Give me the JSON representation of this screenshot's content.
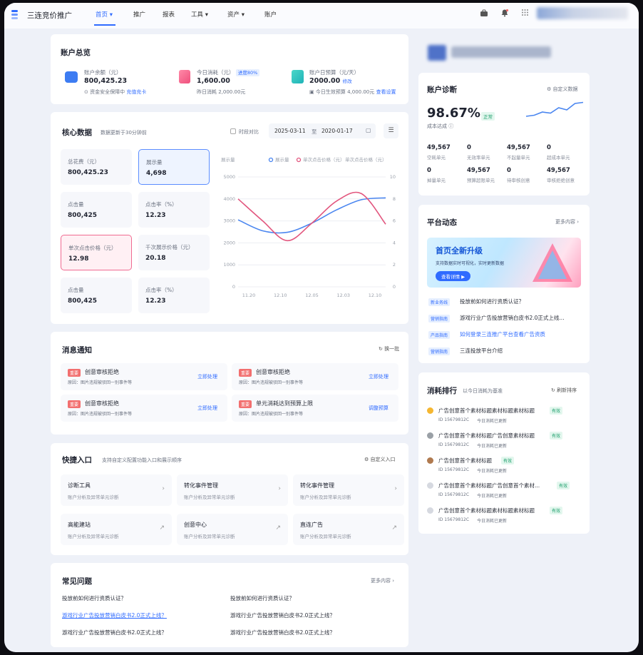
{
  "app": {
    "brand": "三连竞价推广"
  },
  "nav": {
    "items": [
      "首页 ▾",
      "推广",
      "报表",
      "工具 ▾",
      "资产 ▾",
      "账户"
    ]
  },
  "overview": {
    "title": "账户总览",
    "balance": {
      "label": "账户余额（元）",
      "value": "800,425.23",
      "sub": "资金安全保障中",
      "link": "充值充卡"
    },
    "today": {
      "label": "今日消耗（元）",
      "badge": "进度80%",
      "value": "1,600.00",
      "sub": "昨日消耗 2,000.00元"
    },
    "budget": {
      "label": "账户日预算（元/天）",
      "value": "2000.00",
      "edit": "修改",
      "sub": "今日生效预算 4,000.00元",
      "link": "查看设置"
    }
  },
  "core": {
    "title": "核心数据",
    "subtitle": "数据更新于30分钟前",
    "compare_label": "时段对比",
    "date_start": "2025-03-11",
    "date_sep": "至",
    "date_end": "2020-01-17",
    "tiles": [
      {
        "label": "总花费（元）",
        "value": "800,425.23"
      },
      {
        "label": "展示量",
        "value": "4,698"
      },
      {
        "label": "点击量",
        "value": "800,425"
      },
      {
        "label": "点击率（%）",
        "value": "12.23"
      },
      {
        "label": "单次点击价格（元）",
        "value": "12.98"
      },
      {
        "label": "千次展示价格（元）",
        "value": "20.18"
      },
      {
        "label": "点击量",
        "value": "800,425"
      },
      {
        "label": "点击率（%）",
        "value": "12.23"
      }
    ]
  },
  "chart_data": {
    "type": "line",
    "x": [
      "11.20",
      "12.10",
      "12.05",
      "12.03",
      "12.10"
    ],
    "yleft_label": "展示量",
    "yleft_ticks": [
      0,
      1000,
      2000,
      3000,
      4000,
      5000
    ],
    "yright_ticks": [
      0,
      2,
      4,
      6,
      8,
      10
    ],
    "legend": [
      "展示量",
      "单次点击价格（元）",
      "单次点击价格（元）"
    ],
    "series": [
      {
        "name": "展示量",
        "axis": "left",
        "color": "#4a86f0",
        "values": [
          3050,
          2550,
          2480,
          2900,
          3500,
          3960,
          4050
        ]
      },
      {
        "name": "单次点击价格（元）",
        "axis": "right",
        "color": "#e2567e",
        "values": [
          8.0,
          6.0,
          4.2,
          5.8,
          7.8,
          8.5,
          5.7
        ]
      }
    ],
    "ylim_left": [
      0,
      5000
    ],
    "ylim_right": [
      0,
      10
    ]
  },
  "messages": {
    "title": "消息通知",
    "refresh": "换一批",
    "items": [
      {
        "tag": "重要",
        "title": "创意审核拒绝",
        "desc": "原因：图片违规被驳回一别事件等",
        "action": "立即处理"
      },
      {
        "tag": "重要",
        "title": "创意审核拒绝",
        "desc": "原因：图片违规被驳回一别事件等",
        "action": "立即处理"
      },
      {
        "tag": "重要",
        "title": "创意审核拒绝",
        "desc": "原因：图片违规被驳回一别事件等",
        "action": "立即处理"
      },
      {
        "tag": "重要",
        "title": "单元消耗达到预算上限",
        "desc": "原因：图片违规被驳回一别事件等",
        "action": "调整预算"
      }
    ]
  },
  "quick": {
    "title": "快捷入口",
    "subtitle": "支持自定义配置功能入口和展示顺序",
    "custom": "自定义入口",
    "items": [
      {
        "title": "诊断工具",
        "desc": "账户分析及异常单元诊断",
        "arrow": "›"
      },
      {
        "title": "转化事件管理",
        "desc": "账户分析及异常单元诊断",
        "arrow": "›"
      },
      {
        "title": "转化事件管理",
        "desc": "账户分析及异常单元诊断",
        "arrow": "›"
      },
      {
        "title": "高能建站",
        "desc": "账户分析及异常单元诊断",
        "arrow": "↗"
      },
      {
        "title": "创意中心",
        "desc": "账户分析及异常单元诊断",
        "arrow": "↗"
      },
      {
        "title": "直连广告",
        "desc": "账户分析及异常单元诊断",
        "arrow": "↗"
      }
    ]
  },
  "faq": {
    "title": "常见问题",
    "more": "更多内容 ›",
    "items": [
      "投放前如何进行资质认证？",
      "投放前如何进行资质认证？",
      "游戏行业广告投放营销白皮书2.0正式上线？",
      "游戏行业广告投放营销白皮书2.0正式上线？",
      "游戏行业广告投放营销白皮书2.0正式上线？",
      "游戏行业广告投放营销白皮书2.0正式上线？"
    ]
  },
  "diagnosis": {
    "title": "账户诊断",
    "custom": "自定义数据",
    "score": "98.67%",
    "score_badge": "正常",
    "score_label": "成本达成",
    "sparkline": [
      0.3,
      0.35,
      0.5,
      0.45,
      0.7,
      0.6,
      0.9,
      0.95
    ],
    "stats": [
      {
        "value": "49,567",
        "label": "空耗单元"
      },
      {
        "value": "0",
        "label": "无效率单元"
      },
      {
        "value": "49,567",
        "label": "不起量单元"
      },
      {
        "value": "0",
        "label": "超成本单元"
      },
      {
        "value": "0",
        "label": "掉量单元"
      },
      {
        "value": "49,567",
        "label": "预算超限单元"
      },
      {
        "value": "0",
        "label": "待审核创意"
      },
      {
        "value": "49,567",
        "label": "审核拒绝创意"
      }
    ]
  },
  "platform": {
    "title": "平台动态",
    "more": "更多内容 ›",
    "banner_title": "首页全新升级",
    "banner_sub": "支持数据实时可视化，实时更新数据",
    "banner_btn": "查看详情 ▶",
    "items": [
      {
        "tag": "新业务线",
        "text": "投放前如何进行资质认证？"
      },
      {
        "tag": "营销指南",
        "text": "游戏行业广告投放营销白皮书2.0正式上线..."
      },
      {
        "tag": "产品指南",
        "text": "如何登录三连推广平台查看广告资质"
      },
      {
        "tag": "营销指南",
        "text": "三连投放平台介绍"
      }
    ]
  },
  "ranking": {
    "title": "消耗排行",
    "subtitle": "以今日消耗为基准",
    "refresh": "刷新排序",
    "items": [
      {
        "title": "广告创意首个素材标题素材标题素材标题",
        "badge": "有效",
        "id": "ID 15679812C",
        "time": "今日消耗已更新",
        "dot": "#f5b731"
      },
      {
        "title": "广告创意首个素材标题广告创意素材标题",
        "badge": "有效",
        "id": "ID 15679812C",
        "time": "今日消耗已更新",
        "dot": "#9aa0a6"
      },
      {
        "title": "广告创意首个素材标题",
        "badge": "有效",
        "id": "ID 15679812C",
        "time": "今日消耗已更新",
        "dot": "#b07a4f"
      },
      {
        "title": "广告创意首个素材标题广告创意首个素材...",
        "badge": "有效",
        "id": "ID 15679812C",
        "time": "今日消耗已更新",
        "dot": "#d6d9e0"
      },
      {
        "title": "广告创意首个素材标题素材标题素材标题",
        "badge": "有效",
        "id": "ID 15679812C",
        "time": "今日消耗已更新",
        "dot": "#d6d9e0"
      }
    ]
  }
}
